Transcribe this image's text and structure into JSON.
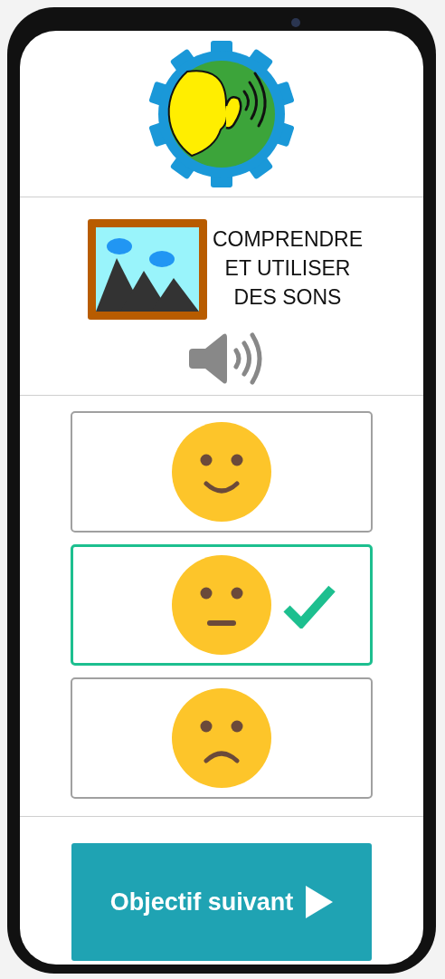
{
  "title": "COMPRENDRE\nET UTILISER\nDES SONS",
  "options": [
    {
      "kind": "happy",
      "selected": false
    },
    {
      "kind": "neutral",
      "selected": true
    },
    {
      "kind": "sad",
      "selected": false
    }
  ],
  "next_button": {
    "label": "Objectif suivant"
  }
}
